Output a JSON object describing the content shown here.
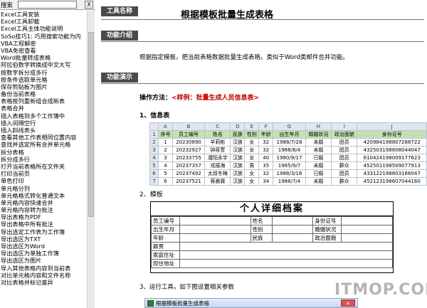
{
  "sidebar": {
    "search_label": "搜索",
    "search_value": "",
    "clear_label": "X",
    "items": [
      "Excel工具安装",
      "Excel工具卸载",
      "Excel工具主体功能说明",
      "SoSo技巧1: 巧用搜索功能为内",
      "VBA工程解密",
      "VBA免密查看",
      "Word批量转成表格",
      "阿拉伯数字转换成中文大写",
      "按数字拆分成多行",
      "按条件选取单元格",
      "保存剪贴板为图片",
      "备份当前表格",
      "表格按列重新组合成新表",
      "表格合并",
      "插入表格到多个工作簿中",
      "插入间隔空行",
      "插入斜线表头",
      "查看其他工作表相同位置内容",
      "查找并选定所有合并单元格",
      "拆分表格",
      "拆分成多行",
      "打开当前表格所在文件夹",
      "打印当前页",
      "单色打印",
      "单元格分列",
      "单元格格式转化普通文本",
      "单元格内容快速合并",
      "单元格内容转为批注",
      "导出表格为PDF",
      "导出表格中所有批注",
      "导出选定工作表为工作簿",
      "导出选区为TXT",
      "导出选区为Word",
      "导出选区为单独工作簿",
      "导出选区为图片",
      "导入其他表格内容到当前表",
      "对比单元格内容和文件名称",
      "对比表格并标记差异"
    ]
  },
  "main": {
    "tool_name_tab": "工具名称",
    "title": "根据模板批量生成表格",
    "intro_tab": "功能介绍",
    "intro_text": "根据指定模板，把当前表格数据批量生成表格。类似于Word类邮件合并功能。",
    "demo_tab": "功能演示",
    "op_method_label": "操作方法：",
    "op_method_example": "<样例：批量生成人员信息表>",
    "info_heading": "1、信息表",
    "template_heading": "2、模板",
    "run_heading": "3、运行工具，如下图设置相关参数"
  },
  "sheet": {
    "col_letters": [
      "A",
      "B",
      "C",
      "D",
      "E",
      "F",
      "G",
      "H",
      "I",
      "J"
    ],
    "row_numbers": [
      "1",
      "2",
      "3",
      "4",
      "5",
      "6",
      "7"
    ],
    "headers": [
      "序号",
      "员工编号",
      "姓名",
      "民族",
      "性别",
      "年龄",
      "出生年月",
      "婚姻状况",
      "政治面貌",
      "身份证号"
    ],
    "rows": [
      [
        "1",
        "20230890",
        "羊莉彬",
        "汉族",
        "女",
        "32",
        "1988/7/28",
        "未婚",
        "团员",
        "420984198807288722"
      ],
      [
        "2",
        "20232927",
        "钟奇萱",
        "汉族",
        "女",
        "32",
        "1988/8/4",
        "未婚",
        "团员",
        "432503198808044047"
      ],
      [
        "3",
        "20233755",
        "濮阳永宇",
        "汉族",
        "女",
        "40",
        "1980/9/17",
        "已婚",
        "团员",
        "610424198009177623"
      ],
      [
        "4",
        "20237357",
        "戎振海",
        "汉族",
        "男",
        "35",
        "1985/9/7",
        "未婚",
        "群众",
        "452501198509077913"
      ],
      [
        "5",
        "20237492",
        "太叔冬梅",
        "汉族",
        "女",
        "32",
        "1988/3/16",
        "已婚",
        "团员",
        "433122198803166047"
      ],
      [
        "6",
        "20237521",
        "蒋晨霖",
        "汉族",
        "女",
        "34",
        "1986/7/4",
        "未婚",
        "群众",
        "452123198607044160"
      ]
    ]
  },
  "form": {
    "title": "个人详细档案",
    "labels": {
      "employee_no": "员工编号",
      "name": "姓名",
      "id_no": "身份证号",
      "birth": "出生年月",
      "gender": "性别",
      "marital": "婚姻状况",
      "age": "年龄",
      "ethnic": "民族",
      "political": "政治面貌",
      "native_place": "籍贯",
      "home_address": "家庭住址",
      "current_address": "现住地址"
    }
  },
  "dialog": {
    "title": "根据模板批量生成表格",
    "close_label": "✕"
  },
  "watermark": "ITMOP.COM",
  "colors": {
    "tab_bg": "#4a4a4a",
    "accent_red": "#c00000",
    "header_green": "#c6e0b4"
  }
}
